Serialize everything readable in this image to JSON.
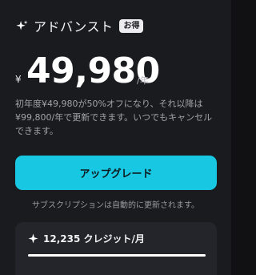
{
  "plan": {
    "name": "アドバンスト",
    "badge": "お得",
    "icon": "sparkle-icon"
  },
  "price": {
    "currency": "¥",
    "amount": "49,980",
    "unit": "/年"
  },
  "description": "初年度¥49,980が50%オフになり、それ以降は¥99,800/年で更新できます。いつでもキャンセルできます。",
  "upgrade_button": {
    "label": "アップグレード",
    "color": "#18c8e2"
  },
  "renew_note": "サブスクリプションは自動的に更新されます。",
  "credits": {
    "icon": "sparkle-icon",
    "label": "12,235 クレジット/月",
    "progress": 1.0
  }
}
